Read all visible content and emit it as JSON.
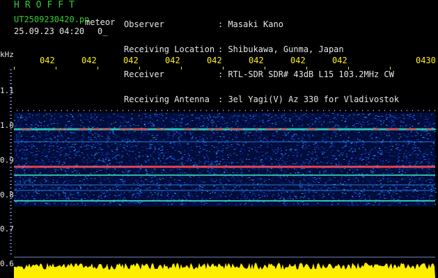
{
  "header": {
    "app_title": "HROFFT",
    "filename": "UT2509230420.pn",
    "meteor_tag": "meteor",
    "timestamp": "25.09.23 04:20",
    "frame_index": "0_",
    "info": [
      {
        "key": "Observer",
        "value": ": Masaki Kano"
      },
      {
        "key": "Receiving Location",
        "value": ": Shibukawa, Gunma, Japan"
      },
      {
        "key": "Receiver",
        "value": ": RTL-SDR SDR# 43dB L15 103.2MHz CW"
      },
      {
        "key": "Receiving Antenna",
        "value": ": 3el Yagi(V) Az 330 for Vladivostok"
      }
    ]
  },
  "axis": {
    "y_unit": "kHz",
    "y_ticks": [
      "1.1",
      "1.0",
      "0.9",
      "0.8",
      "0.7",
      "0.6"
    ],
    "x_ticks": [
      "042",
      "042",
      "042",
      "042",
      "042",
      "042",
      "042",
      "042",
      "0430"
    ]
  },
  "colors": {
    "background": "#000000",
    "title": "#33cc33",
    "labels": "#e6e6e6",
    "time_ticks": "#ffee22",
    "noise_band": "#ffee00"
  }
}
